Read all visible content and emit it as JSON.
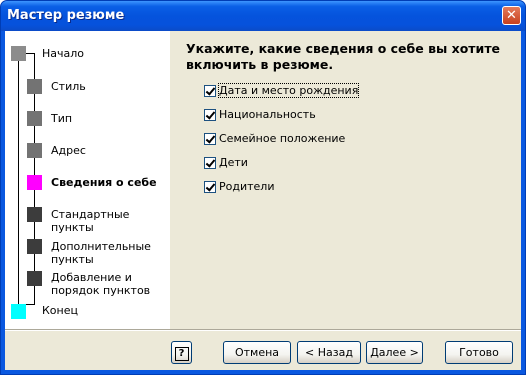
{
  "window": {
    "title": "Мастер резюме"
  },
  "steps": [
    {
      "label": "Начало"
    },
    {
      "label": "Стиль"
    },
    {
      "label": "Тип"
    },
    {
      "label": "Адрес"
    },
    {
      "label": "Сведения о себе"
    },
    {
      "label": "Стандартные пункты"
    },
    {
      "label": "Дополнительные пункты"
    },
    {
      "label": "Добавление и порядок пунктов"
    },
    {
      "label": "Конец"
    }
  ],
  "main": {
    "heading": "Укажите, какие сведения о себе вы хотите включить в резюме.",
    "options": [
      {
        "label": "Дата и место рождения",
        "checked": true
      },
      {
        "label": "Национальность",
        "checked": true
      },
      {
        "label": "Семейное положение",
        "checked": true
      },
      {
        "label": "Дети",
        "checked": true
      },
      {
        "label": "Родители",
        "checked": true
      }
    ]
  },
  "buttons": {
    "help": "?",
    "cancel": "Отмена",
    "back": "< Назад",
    "next": "Далее >",
    "finish": "Готово"
  }
}
